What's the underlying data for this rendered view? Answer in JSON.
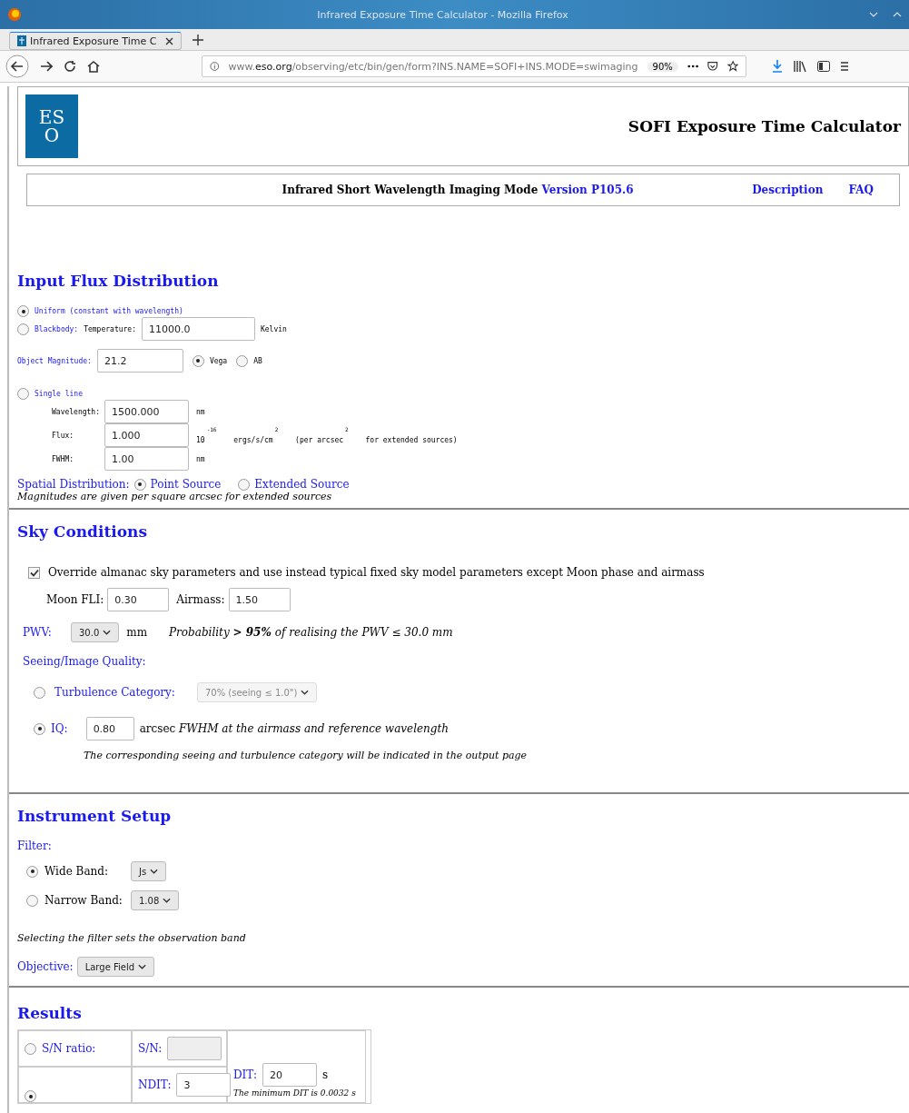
{
  "window": {
    "title": "Infrared Exposure Time Calculator - Mozilla Firefox"
  },
  "tabs": [
    {
      "label": "Infrared Exposure Time C",
      "selected": true
    }
  ],
  "address_bar": {
    "prefix": "www.",
    "domain": "eso.org",
    "path": "/observing/etc/bin/gen/form?INS.NAME=SOFI+INS.MODE=swimaging",
    "zoom": "90%"
  },
  "header": {
    "logo_letters": [
      "ES",
      "O"
    ],
    "title": "SOFI Exposure Time Calculator"
  },
  "mode_bar": {
    "mode": "Infrared Short Wavelength Imaging Mode",
    "version": "Version P105.6",
    "links": [
      "Description",
      "FAQ"
    ]
  },
  "flux": {
    "heading": "Input Flux Distribution",
    "uniform": {
      "label": "Uniform (constant with wavelength)",
      "selected": true
    },
    "blackbody": {
      "label": "Blackbody:",
      "selected": false,
      "temp_label": "Temperature:",
      "temp_value": "11000.0",
      "unit": "Kelvin"
    },
    "magnitude": {
      "label": "Object Magnitude:",
      "value": "21.2",
      "systems": [
        {
          "label": "Vega",
          "selected": true
        },
        {
          "label": "AB",
          "selected": false
        }
      ]
    },
    "single_line": {
      "label": "Single line",
      "selected": false,
      "rows": [
        {
          "label": "Wavelength:",
          "value": "1500.000",
          "kind": "plain",
          "unit": "nm"
        },
        {
          "label": "Flux:",
          "value": "1.000",
          "kind": "flux",
          "unit": "10",
          "exp": "-16",
          "unit2": "ergs/s/cm",
          "exp2": "2",
          "unit3": "(per arcsec",
          "exp3": "2",
          "unit4": "for extended sources)"
        },
        {
          "label": "FWHM:",
          "value": "1.00",
          "kind": "plain",
          "unit": "nm"
        }
      ]
    },
    "spatial": {
      "label": "Spatial Distribution:",
      "options": [
        {
          "label": "Point Source",
          "selected": true
        },
        {
          "label": "Extended Source",
          "selected": false
        }
      ],
      "note": "Magnitudes are given per square arcsec for extended sources"
    }
  },
  "sky": {
    "heading": "Sky Conditions",
    "override": {
      "label": "Override almanac sky parameters and use instead typical fixed sky model parameters except Moon phase and airmass",
      "checked": true
    },
    "moon_label": "Moon FLI:",
    "moon_value": "0.30",
    "airmass_label": "Airmass:",
    "airmass_value": "1.50",
    "pwv_label": "PWV:",
    "pwv_value": "30.0",
    "pwv_unit": "mm",
    "probability": "*Probability* **> 95%** *of realising the PWV ≤ 30.0 mm*",
    "seeing_label": "Seeing/Image Quality:",
    "turbulence": {
      "label": "Turbulence Category:",
      "value": "70% (seeing ≤ 1.0\")",
      "selected": false,
      "disabled": true
    },
    "iq": {
      "label": "IQ:",
      "value": "0.80",
      "selected": true,
      "unit": "arcsec *FWHM at the airmass and reference wavelength*"
    },
    "iq_note": "The corresponding seeing and turbulence category will be indicated in the output page"
  },
  "instrument": {
    "heading": "Instrument Setup",
    "filter_label": "Filter:",
    "filters": [
      {
        "label": "Wide Band:",
        "value": "Js",
        "selected": true
      },
      {
        "label": "Narrow Band:",
        "value": "1.08",
        "selected": false
      }
    ],
    "filter_note": "Selecting the filter sets the observation band",
    "objective_label": "Objective:",
    "objective_value": "Large Field"
  },
  "results": {
    "heading": "Results",
    "sn": {
      "label": "S/N ratio:",
      "selected": false,
      "field_label": "S/N:"
    },
    "exptime": {
      "selected": true,
      "ndit_label": "NDIT:",
      "ndit_value": "3"
    },
    "dit_label": "DIT:",
    "dit_value": "20",
    "dit_unit": "s",
    "dit_note": "The minimum DIT is 0.0032 s"
  }
}
